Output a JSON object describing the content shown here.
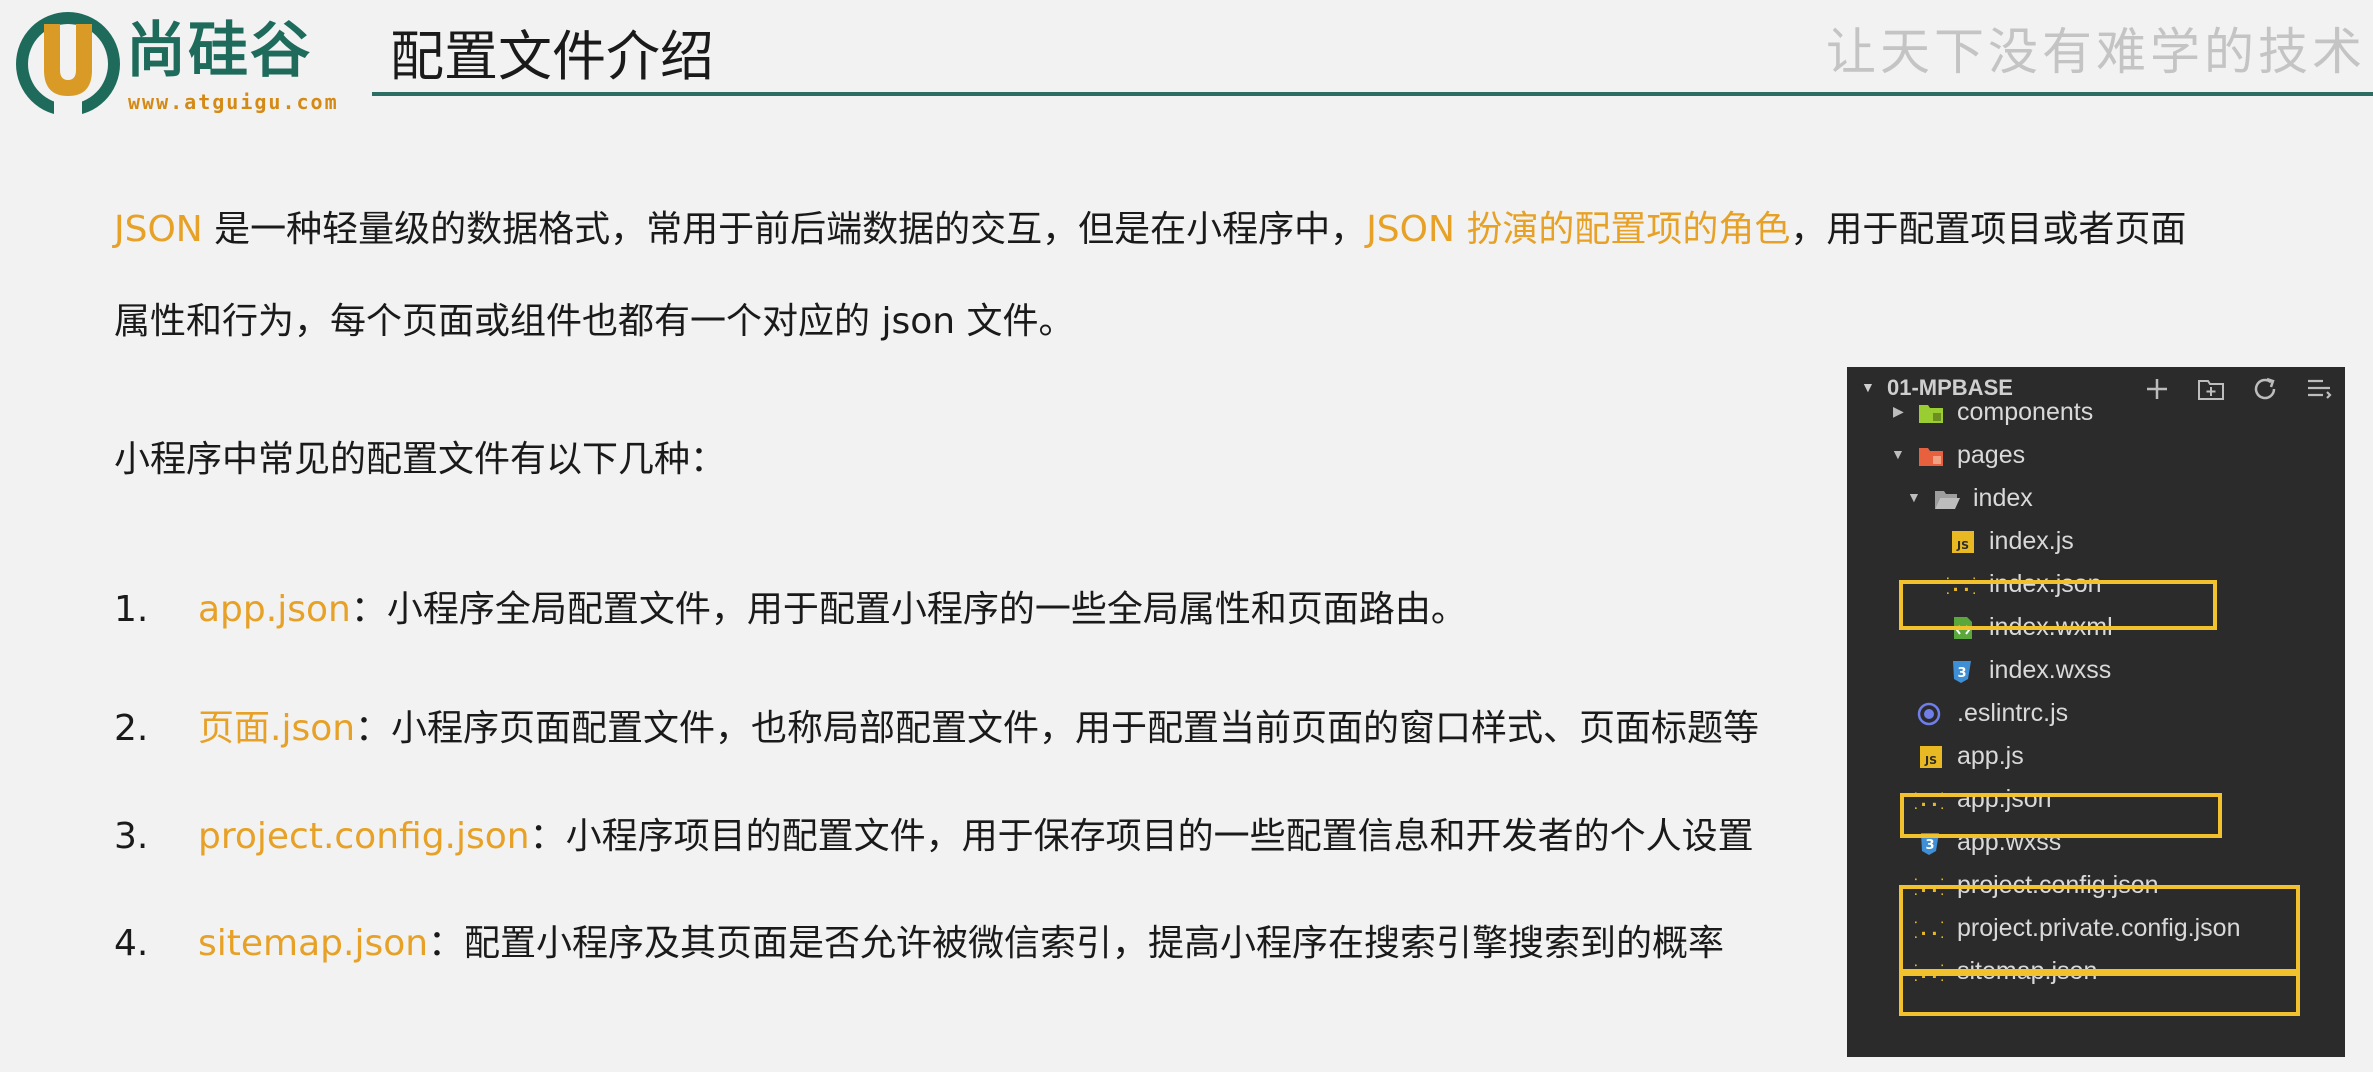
{
  "header": {
    "logo_cn": "尚硅谷",
    "logo_url": "www.atguigu.com",
    "title": "配置文件介绍",
    "slogan": "让天下没有难学的技术"
  },
  "intro": {
    "line1_a": "JSON",
    "line1_b": " 是一种轻量级的数据格式，常用于前后端数据的交互，但是在小程序中，",
    "line1_c": "JSON 扮演的配置项的角色",
    "line1_d": "，用于配置项目或者页面",
    "line2": "属性和行为，每个页面或组件也都有一个对应的 json 文件。"
  },
  "list_heading": "小程序中常见的配置文件有以下几种：",
  "items": [
    {
      "num": "1.",
      "name": "app.json",
      "desc": "：小程序全局配置文件，用于配置小程序的一些全局属性和页面路由。"
    },
    {
      "num": "2.",
      "name": "页面.json",
      "desc": "：小程序页面配置文件，也称局部配置文件，用于配置当前页面的窗口样式、页面标题等"
    },
    {
      "num": "3.",
      "name": "project.config.json",
      "desc": "：小程序项目的配置文件，用于保存项目的一些配置信息和开发者的个人设置"
    },
    {
      "num": "4.",
      "name": "sitemap.json",
      "desc": "：配置小程序及其页面是否允许被微信索引，提高小程序在搜索引擎搜索到的概率"
    }
  ],
  "tree": {
    "root": "01-MPBASE",
    "tools": [
      "new-file-icon",
      "new-folder-icon",
      "refresh-icon",
      "collapse-all-icon"
    ],
    "rows": [
      {
        "label": "components",
        "icon": "components-folder-icon"
      },
      {
        "label": "pages",
        "icon": "pages-folder-icon"
      },
      {
        "label": "index",
        "icon": "folder-open-icon"
      },
      {
        "label": "index.js",
        "icon": "js-file-icon"
      },
      {
        "label": "index.json",
        "icon": "json-file-icon"
      },
      {
        "label": "index.wxml",
        "icon": "wxml-file-icon"
      },
      {
        "label": "index.wxss",
        "icon": "wxss-file-icon"
      },
      {
        "label": ".eslintrc.js",
        "icon": "eslint-file-icon"
      },
      {
        "label": "app.js",
        "icon": "js-file-icon"
      },
      {
        "label": "app.json",
        "icon": "json-file-icon"
      },
      {
        "label": "app.wxss",
        "icon": "wxss-file-icon"
      },
      {
        "label": "project.config.json",
        "icon": "json-file-icon"
      },
      {
        "label": "project.private.config.json",
        "icon": "json-file-icon"
      },
      {
        "label": "sitemap.json",
        "icon": "json-file-icon"
      }
    ]
  },
  "colors": {
    "accent": "#e6a126",
    "brand": "#1e6b5c",
    "highlight_box": "#f2c12e",
    "panel_bg": "#2b2b2b"
  }
}
